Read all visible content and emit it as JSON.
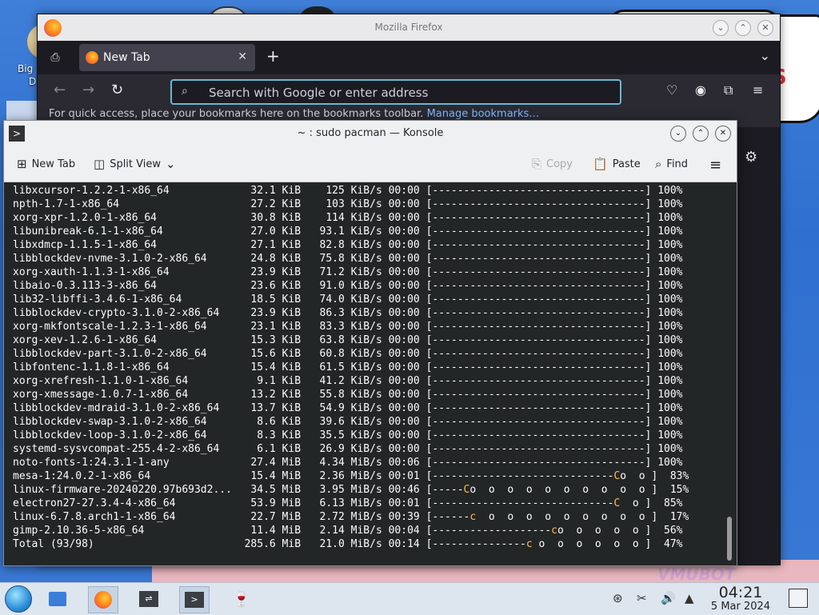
{
  "desktop": {
    "icon_label_line1": "Big",
    "icon_label_line2": "D",
    "watermark": "VMUBOT",
    "wall_letters": "S"
  },
  "firefox": {
    "window_title": "Mozilla Firefox",
    "tab_label": "New Tab",
    "address_placeholder": "Search with Google or enter address",
    "bookmarks_hint": "For quick access, place your bookmarks here on the bookmarks toolbar.",
    "bookmarks_link": "Manage bookmarks…"
  },
  "konsole": {
    "window_title": "~ : sudo pacman — Konsole",
    "toolbar": {
      "new_tab": "New Tab",
      "split_view": "Split View",
      "copy": "Copy",
      "paste": "Paste",
      "find": "Find"
    },
    "rows": [
      {
        "name": "libxcursor-1.2.2-1-x86_64",
        "size": "32.1 KiB",
        "rate": "125 KiB/s",
        "eta": "00:00",
        "bar": "[----------------------------------]",
        "pct": "100%"
      },
      {
        "name": "npth-1.7-1-x86_64",
        "size": "27.2 KiB",
        "rate": "103 KiB/s",
        "eta": "00:00",
        "bar": "[----------------------------------]",
        "pct": "100%"
      },
      {
        "name": "xorg-xpr-1.2.0-1-x86_64",
        "size": "30.8 KiB",
        "rate": "114 KiB/s",
        "eta": "00:00",
        "bar": "[----------------------------------]",
        "pct": "100%"
      },
      {
        "name": "libunibreak-6.1-1-x86_64",
        "size": "27.0 KiB",
        "rate": "93.1 KiB/s",
        "eta": "00:00",
        "bar": "[----------------------------------]",
        "pct": "100%"
      },
      {
        "name": "libxdmcp-1.1.5-1-x86_64",
        "size": "27.1 KiB",
        "rate": "82.8 KiB/s",
        "eta": "00:00",
        "bar": "[----------------------------------]",
        "pct": "100%"
      },
      {
        "name": "libblockdev-nvme-3.1.0-2-x86_64",
        "size": "24.8 KiB",
        "rate": "75.8 KiB/s",
        "eta": "00:00",
        "bar": "[----------------------------------]",
        "pct": "100%"
      },
      {
        "name": "xorg-xauth-1.1.3-1-x86_64",
        "size": "23.9 KiB",
        "rate": "71.2 KiB/s",
        "eta": "00:00",
        "bar": "[----------------------------------]",
        "pct": "100%"
      },
      {
        "name": "libaio-0.3.113-3-x86_64",
        "size": "23.6 KiB",
        "rate": "91.0 KiB/s",
        "eta": "00:00",
        "bar": "[----------------------------------]",
        "pct": "100%"
      },
      {
        "name": "lib32-libffi-3.4.6-1-x86_64",
        "size": "18.5 KiB",
        "rate": "74.0 KiB/s",
        "eta": "00:00",
        "bar": "[----------------------------------]",
        "pct": "100%"
      },
      {
        "name": "libblockdev-crypto-3.1.0-2-x86_64",
        "size": "23.9 KiB",
        "rate": "86.3 KiB/s",
        "eta": "00:00",
        "bar": "[----------------------------------]",
        "pct": "100%"
      },
      {
        "name": "xorg-mkfontscale-1.2.3-1-x86_64",
        "size": "23.1 KiB",
        "rate": "83.3 KiB/s",
        "eta": "00:00",
        "bar": "[----------------------------------]",
        "pct": "100%"
      },
      {
        "name": "xorg-xev-1.2.6-1-x86_64",
        "size": "15.3 KiB",
        "rate": "63.8 KiB/s",
        "eta": "00:00",
        "bar": "[----------------------------------]",
        "pct": "100%"
      },
      {
        "name": "libblockdev-part-3.1.0-2-x86_64",
        "size": "15.6 KiB",
        "rate": "60.8 KiB/s",
        "eta": "00:00",
        "bar": "[----------------------------------]",
        "pct": "100%"
      },
      {
        "name": "libfontenc-1.1.8-1-x86_64",
        "size": "15.4 KiB",
        "rate": "61.5 KiB/s",
        "eta": "00:00",
        "bar": "[----------------------------------]",
        "pct": "100%"
      },
      {
        "name": "xorg-xrefresh-1.1.0-1-x86_64",
        "size": "9.1 KiB",
        "rate": "41.2 KiB/s",
        "eta": "00:00",
        "bar": "[----------------------------------]",
        "pct": "100%"
      },
      {
        "name": "xorg-xmessage-1.0.7-1-x86_64",
        "size": "13.2 KiB",
        "rate": "55.8 KiB/s",
        "eta": "00:00",
        "bar": "[----------------------------------]",
        "pct": "100%"
      },
      {
        "name": "libblockdev-mdraid-3.1.0-2-x86_64",
        "size": "13.7 KiB",
        "rate": "54.9 KiB/s",
        "eta": "00:00",
        "bar": "[----------------------------------]",
        "pct": "100%"
      },
      {
        "name": "libblockdev-swap-3.1.0-2-x86_64",
        "size": "8.6 KiB",
        "rate": "39.6 KiB/s",
        "eta": "00:00",
        "bar": "[----------------------------------]",
        "pct": "100%"
      },
      {
        "name": "libblockdev-loop-3.1.0-2-x86_64",
        "size": "8.3 KiB",
        "rate": "35.5 KiB/s",
        "eta": "00:00",
        "bar": "[----------------------------------]",
        "pct": "100%"
      },
      {
        "name": "systemd-sysvcompat-255.4-2-x86_64",
        "size": "6.1 KiB",
        "rate": "26.9 KiB/s",
        "eta": "00:00",
        "bar": "[----------------------------------]",
        "pct": "100%"
      },
      {
        "name": "noto-fonts-1:24.3.1-1-any",
        "size": "27.4 MiB",
        "rate": "4.34 MiB/s",
        "eta": "00:06",
        "bar": "[----------------------------------]",
        "pct": "100%"
      },
      {
        "name": "mesa-1:24.0.2-1-x86_64",
        "size": "15.4 MiB",
        "rate": "2.36 MiB/s",
        "eta": "00:01",
        "bar": "[-----------------------------Co  o ]",
        "pct": "83%"
      },
      {
        "name": "linux-firmware-20240220.97b693d2...",
        "size": "34.5 MiB",
        "rate": "3.95 MiB/s",
        "eta": "00:46",
        "bar": "[-----Co  o  o  o  o  o  o  o  o  o ]",
        "pct": "15%"
      },
      {
        "name": "electron27-27.3.4-4-x86_64",
        "size": "53.9 MiB",
        "rate": "6.13 MiB/s",
        "eta": "00:01",
        "bar": "[-----------------------------C  o ]",
        "pct": "85%"
      },
      {
        "name": "linux-6.7.8.arch1-1-x86_64",
        "size": "22.7 MiB",
        "rate": "2.72 MiB/s",
        "eta": "00:39",
        "bar": "[------c  o  o  o  o  o  o  o  o  o ]",
        "pct": "17%"
      },
      {
        "name": "gimp-2.10.36-5-x86_64",
        "size": "11.4 MiB",
        "rate": "2.14 MiB/s",
        "eta": "00:04",
        "bar": "[-------------------co  o  o  o  o ]",
        "pct": "56%"
      },
      {
        "name": "Total (93/98)",
        "size": "285.6 MiB",
        "rate": "21.0 MiB/s",
        "eta": "00:14",
        "bar": "[---------------c o  o  o  o  o  o ]",
        "pct": "47%"
      }
    ]
  },
  "taskbar": {
    "time": "04:21",
    "date": "5 Mar 2024"
  },
  "colors": {
    "terminal_bg": "#232627",
    "terminal_fg": "#fcfcfc",
    "pacman_yellow": "#fdbc4b",
    "firefox_dark": "#1c1b22",
    "urlbar_focus": "#6ab8cf"
  }
}
